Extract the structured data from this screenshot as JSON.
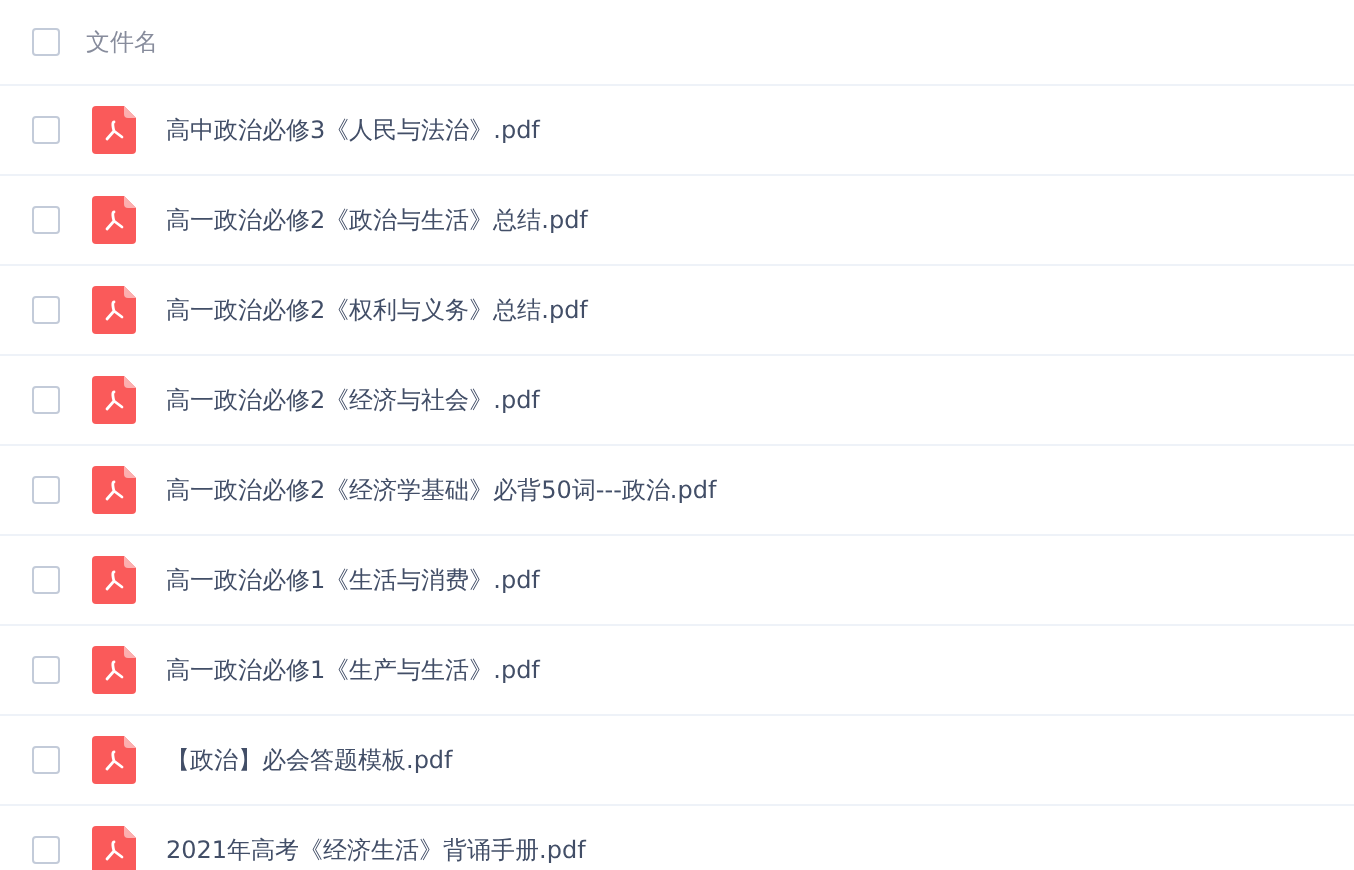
{
  "table": {
    "header": {
      "label": "文件名",
      "checked": false
    },
    "rows": [
      {
        "name": "高中政治必修3《人民与法治》.pdf",
        "checked": false
      },
      {
        "name": "高一政治必修2《政治与生活》总结.pdf",
        "checked": false
      },
      {
        "name": "高一政治必修2《权利与义务》总结.pdf",
        "checked": false
      },
      {
        "name": "高一政治必修2《经济与社会》.pdf",
        "checked": false
      },
      {
        "name": "高一政治必修2《经济学基础》必背50词---政治.pdf",
        "checked": false
      },
      {
        "name": "高一政治必修1《生活与消费》.pdf",
        "checked": false
      },
      {
        "name": "高一政治必修1《生产与生活》.pdf",
        "checked": false
      },
      {
        "name": "【政治】必会答题模板.pdf",
        "checked": false
      },
      {
        "name": "2021年高考《经济生活》背诵手册.pdf",
        "checked": false
      }
    ]
  }
}
